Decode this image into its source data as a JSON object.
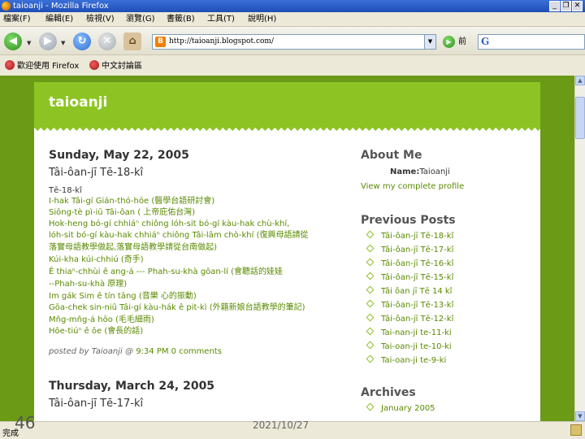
{
  "window": {
    "title": "taioanji - Mozilla Firefox",
    "minimize": "_",
    "restore": "❐",
    "close": "✕"
  },
  "menu": [
    "檔案(F)",
    "編輯(E)",
    "檢視(V)",
    "瀏覽(G)",
    "書籤(B)",
    "工具(T)",
    "說明(H)"
  ],
  "nav": {
    "url": "http://taioanji.blogspot.com/",
    "go_label": "前",
    "search_icon": "G"
  },
  "bookmarks": [
    "歡迎使用 Firefox",
    "中文討論區"
  ],
  "blog": {
    "name": "taioanji",
    "posts": [
      {
        "date": "Sunday, May 22, 2005",
        "title": "Tâi-ôan-jī Tē-18-kî",
        "lines": [
          "Tē-18-kî",
          "I-hak Tâi-gí Gián-thó-hōe (醫學台語研討會)",
          "Siōng-tè pì-iū Tâi-ôan ( 上帝庇佑台灣)",
          "Hok-heng bó-gí chhiáⁿ chiông lóh-sit bó-gí kàu-hak chù-khí,",
          "lóh-sit bó-gí kàu-hak chhiáⁿ chiông Tâi-lâm chò-khí (復興母語請從",
          "落實母語教學做起,落實母語教學請從台南做起)",
          "Kúi-kha kúi-chhiú (奇手)",
          "Ē thiaⁿ-chhùi ê ang-á --- Phah-su-khà gōan-lí (會聽話的娃娃",
          "--Phah-su-khà 原理)",
          "Im gák   Sim ê tín tāng (音樂  心的振動)",
          "Gōa-chek sin-niû Tâi-gí kàu-hák ê pit-kì (外籍新娘台語教學的筆記)",
          "Mn̂g-mn̂g-á hōo (毛毛細雨)",
          "Hōe-tiúⁿ ê ōe (會長的話)"
        ],
        "footer_prefix": "posted by Taioanji @ ",
        "time": "9:34 PM",
        "comments": "0 comments"
      },
      {
        "date": "Thursday, March 24, 2005",
        "title": "Tâi-ôan-jī Tē-17-kî"
      }
    ]
  },
  "sidebar": {
    "about_heading": "About Me",
    "name_label": "Name:",
    "name_value": "Taioanji",
    "profile_link": "View my complete profile",
    "previous_heading": "Previous Posts",
    "previous_posts": [
      "Tâi-ôan-jī Tē-18-kî",
      "Tâi-ôan-jī Tē-17-kî",
      "Tâi-ôan-jī Tē-16-kî",
      "Tâi-ôan-jī Tē-15-kî",
      "Tâi ôan jī Tē 14 kî",
      "Tâi-ôan-jī Tē-13-kî",
      "Tâi-ôan-jī Tē-12-kî",
      "Tai-nan-ji te-11-ki",
      "Tai-oan-ji te-10-ki",
      "Tai-oan-ji te-9-ki"
    ],
    "archives_heading": "Archives",
    "archives": [
      "January 2005"
    ]
  },
  "status": {
    "text": "完成",
    "slide_number": "46",
    "date": "2021/10/27"
  }
}
